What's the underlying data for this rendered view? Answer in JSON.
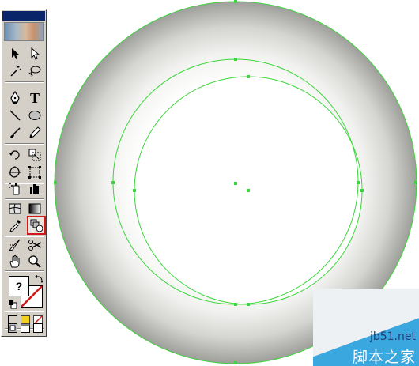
{
  "toolbox": {
    "tools": [
      {
        "name": "selection-tool",
        "icon": "arrow-icon"
      },
      {
        "name": "direct-selection-tool",
        "icon": "hollow-arrow-icon"
      },
      {
        "name": "magic-wand-tool",
        "icon": "magic-wand-icon"
      },
      {
        "name": "lasso-tool",
        "icon": "lasso-icon"
      },
      {
        "name": "pen-tool",
        "icon": "pen-icon"
      },
      {
        "name": "type-tool",
        "icon": "type-icon",
        "label": "T"
      },
      {
        "name": "line-tool",
        "icon": "line-icon"
      },
      {
        "name": "ellipse-tool",
        "icon": "ellipse-icon"
      },
      {
        "name": "paintbrush-tool",
        "icon": "brush-icon"
      },
      {
        "name": "pencil-tool",
        "icon": "pencil-icon"
      },
      {
        "name": "rotate-tool",
        "icon": "rotate-icon"
      },
      {
        "name": "scale-tool",
        "icon": "scale-icon"
      },
      {
        "name": "warp-tool",
        "icon": "warp-icon"
      },
      {
        "name": "free-transform-tool",
        "icon": "free-transform-icon"
      },
      {
        "name": "symbol-sprayer-tool",
        "icon": "sprayer-icon"
      },
      {
        "name": "graph-tool",
        "icon": "bar-graph-icon"
      },
      {
        "name": "mesh-tool",
        "icon": "mesh-icon"
      },
      {
        "name": "gradient-tool",
        "icon": "gradient-icon"
      },
      {
        "name": "eyedropper-tool",
        "icon": "eyedropper-icon"
      },
      {
        "name": "blend-tool",
        "icon": "blend-icon",
        "selected": true
      },
      {
        "name": "slice-tool",
        "icon": "slice-icon"
      },
      {
        "name": "scissors-tool",
        "icon": "scissors-icon"
      },
      {
        "name": "hand-tool",
        "icon": "hand-icon"
      },
      {
        "name": "zoom-tool",
        "icon": "magnifier-icon"
      }
    ],
    "fill_label": "?",
    "selected_color": "#d11818",
    "mode_colors": [
      "#d4d0c8",
      "#f2d01e",
      "#ffffff"
    ]
  },
  "watermark": {
    "url": "jb51.net",
    "site_name": "脚本之家"
  },
  "colors": {
    "path_stroke": "#3bd63b",
    "ring_dark": "#9a9a96",
    "ring_light": "#ffffff",
    "watermark_blue": "#3aa8de"
  }
}
